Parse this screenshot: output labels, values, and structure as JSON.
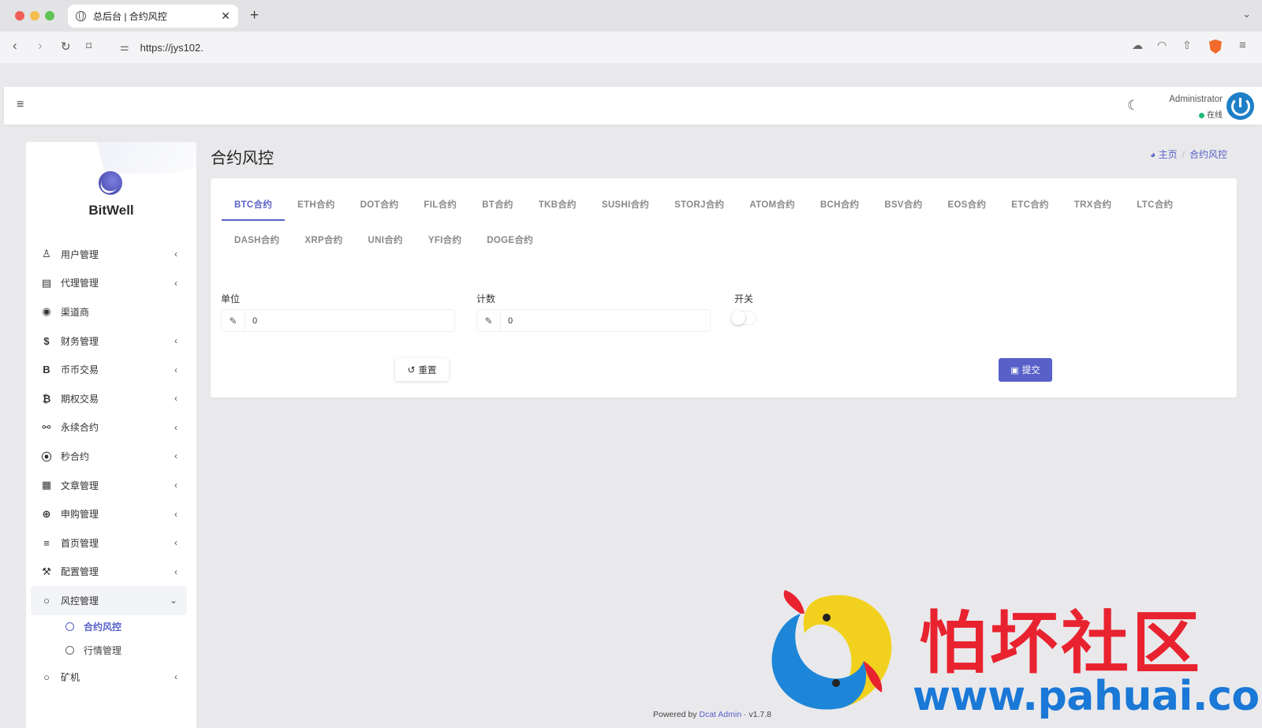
{
  "browser": {
    "tab_title": "总后台 | 合约风控",
    "url": "https://jys102."
  },
  "header": {
    "user_name": "Administrator",
    "user_status": "在线"
  },
  "sidebar": {
    "brand": "BitWell",
    "items": [
      {
        "label": "用户管理",
        "icon": "user-icon",
        "glyph": "♙",
        "arrow": "‹"
      },
      {
        "label": "代理管理",
        "icon": "id-card-icon",
        "glyph": "▤",
        "arrow": "‹"
      },
      {
        "label": "渠道商",
        "icon": "user-circle-icon",
        "glyph": "◉",
        "arrow": ""
      },
      {
        "label": "财务管理",
        "icon": "dollar-icon",
        "glyph": "$",
        "arrow": "‹"
      },
      {
        "label": "币币交易",
        "icon": "bitcoin-b-icon",
        "glyph": "B",
        "arrow": "‹"
      },
      {
        "label": "期权交易",
        "icon": "bitcoin-icon",
        "glyph": "₿",
        "arrow": "‹"
      },
      {
        "label": "永续合约",
        "icon": "link-icon",
        "glyph": "⚯",
        "arrow": "‹"
      },
      {
        "label": "秒合约",
        "icon": "dot-circle-icon",
        "glyph": "⦿",
        "arrow": "‹"
      },
      {
        "label": "文章管理",
        "icon": "newspaper-icon",
        "glyph": "▦",
        "arrow": "‹"
      },
      {
        "label": "申购管理",
        "icon": "life-ring-icon",
        "glyph": "⊕",
        "arrow": "‹"
      },
      {
        "label": "首页管理",
        "icon": "list-icon",
        "glyph": "≡",
        "arrow": "‹"
      },
      {
        "label": "配置管理",
        "icon": "wrench-icon",
        "glyph": "⚒",
        "arrow": "‹"
      },
      {
        "label": "风控管理",
        "icon": "circle-icon",
        "glyph": "○",
        "arrow": "⌄"
      }
    ],
    "sub_items": [
      {
        "label": "合约风控",
        "active": true
      },
      {
        "label": "行情管理",
        "active": false
      }
    ],
    "last_item": {
      "label": "矿机",
      "icon": "circle-icon",
      "glyph": "○",
      "arrow": "‹"
    }
  },
  "page": {
    "title": "合约风控",
    "breadcrumb_home": "主页",
    "breadcrumb_current": "合约风控"
  },
  "contract_tabs_row1": [
    "BTC合约",
    "ETH合约",
    "DOT合约",
    "FIL合约",
    "BT合约",
    "TKB合约",
    "SUSHI合约",
    "STORJ合约",
    "ATOM合约",
    "BCH合约",
    "BSV合约",
    "EOS合约",
    "ETC合约",
    "TRX合约",
    "LTC合约"
  ],
  "contract_tabs_row2": [
    "DASH合约",
    "XRP合约",
    "UNI合约",
    "YFI合约",
    "DOGE合约"
  ],
  "active_tab": "BTC合约",
  "form": {
    "unit_label": "单位",
    "unit_value": "0",
    "count_label": "计数",
    "count_value": "0",
    "switch_label": "开关",
    "switch_on": false,
    "reset_label": "重置",
    "submit_label": "提交"
  },
  "footer": {
    "prefix": "Powered by",
    "link": "Dcat Admin",
    "sep": "·",
    "version": "v1.7.8"
  },
  "watermark": {
    "chinese": "怕坏社区",
    "url": "www.pahuai.com"
  },
  "colors": {
    "accent": "#5961c9",
    "online": "#21b978",
    "watermark_red": "#e8232f",
    "watermark_blue": "#1a78d6"
  }
}
